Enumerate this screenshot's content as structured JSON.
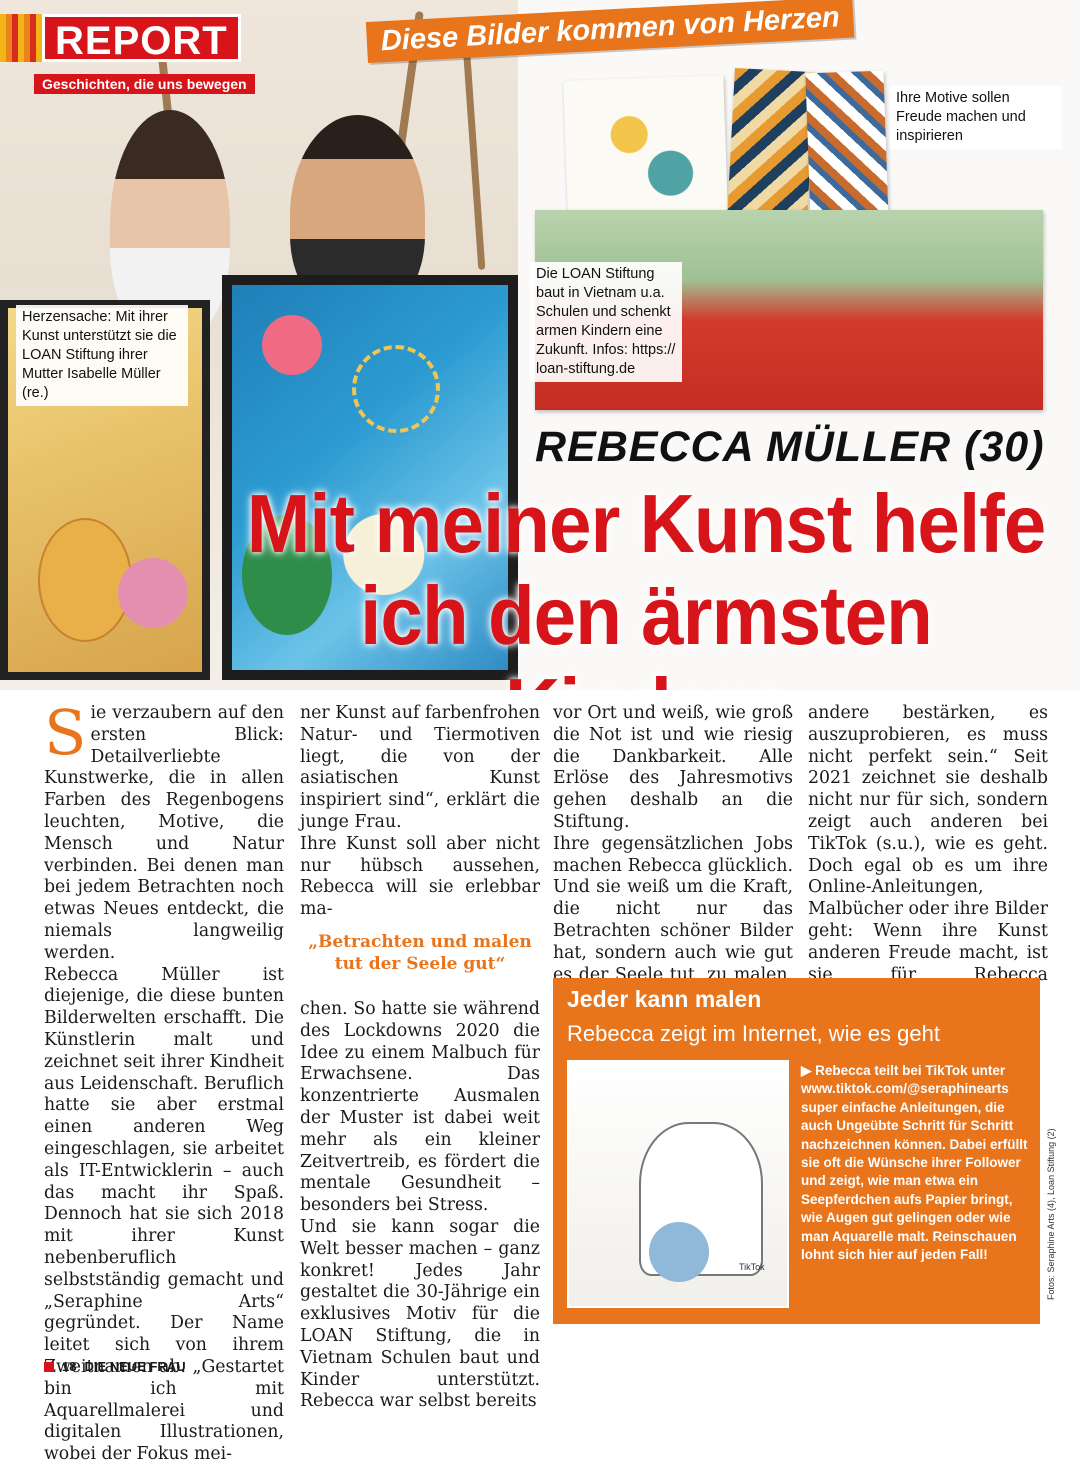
{
  "section": {
    "label": "REPORT",
    "sub": "Geschichten, die uns bewegen"
  },
  "banner": "Diese Bilder kommen von Herzen",
  "captions": {
    "motive": "Ihre Motive sollen Freude machen und inspirieren",
    "loan": "Die LOAN Stiftung baut in Vietnam u.a. Schulen und schenkt armen Kindern eine Zukunft. Infos: https:// loan-stiftung.de",
    "herz": "Herzensache: Mit ihrer Kunst unterstützt sie die LOAN Stiftung ihrer Mutter Isabelle Müller (re.)"
  },
  "kicker": "REBECCA MÜLLER (30)",
  "headline": {
    "line1": "Mit meiner Kunst helfe",
    "line2": "ich den ärmsten Kindern"
  },
  "article": {
    "col1": [
      "ie verzaubern auf den ersten Blick: Detailverliebte Kunstwerke, die in allen Farben des Regenbogens leuchten, Motive, die Mensch und Natur verbinden. Bei denen man bei jedem Betrachten noch etwas Neues entdeckt, die niemals langweilig werden.",
      "Rebecca Müller ist diejenige, die diese bunten Bilderwelten erschafft. Die Künstlerin malt und zeichnet seit ihrer Kindheit aus Leidenschaft. Beruflich hatte sie aber erstmal einen anderen Weg eingeschlagen, sie arbeitet als IT-Entwicklerin – auch das macht ihr Spaß. Dennoch hat sie sich 2018 mit ihrer Kunst nebenberuflich selbstständig gemacht und „Seraphine Arts“ gegründet. Der Name leitet sich von ihrem Zweitnamen ab. „Gestartet bin ich mit Aquarellmalerei und digitalen Illustrationen, wobei der Fokus mei-"
    ],
    "dropcap": "S",
    "col2a": [
      "ner Kunst auf farbenfrohen Natur- und Tiermotiven liegt, die von der asiatischen Kunst inspiriert sind“, erklärt die junge Frau.",
      "Ihre Kunst soll aber nicht nur hübsch aussehen, Rebecca will sie erlebbar ma-"
    ],
    "pullquote": "„Betrachten und malen tut der Seele gut“",
    "col2b": [
      "chen. So hatte sie während des Lockdowns 2020 die Idee zu einem Malbuch für Erwachsene. Das konzentrierte Ausmalen der Muster ist dabei weit mehr als ein kleiner Zeitvertreib, es fördert die mentale Gesundheit – besonders bei Stress.",
      "Und sie kann sogar die Welt besser machen – ganz konkret! Jedes Jahr gestaltet die 30-Jährige ein exklusives Motiv für die LOAN Stiftung, die in Vietnam Schulen baut und Kinder unterstützt. Rebecca war selbst bereits"
    ],
    "col3": [
      "vor Ort und weiß, wie groß die Not ist und wie riesig die Dankbarkeit. Alle Erlöse des Jahresmotivs gehen deshalb an die Stiftung.",
      "Ihre gegensätzlichen Jobs machen Rebecca glücklich. Und sie weiß um die Kraft, die nicht nur das Betrachten schöner Bilder hat, sondern auch wie gut es der Seele tut, zu malen. Sie sagt:„Ich will"
    ],
    "col4": [
      "andere bestärken, es auszuprobieren, es muss nicht perfekt sein.“ Seit 2021 zeichnet sie deshalb nicht nur für sich, sondern zeigt auch anderen bei TikTok (s.u.), wie es geht. Doch egal ob es um ihre Online-Anleitungen, Malbücher oder ihre Bilder geht: Wenn ihre Kunst anderen Freude macht, ist sie für Rebecca erfolgreich."
    ]
  },
  "box": {
    "title": "Jeder kann malen",
    "subtitle": "Rebecca zeigt im Internet, wie es geht",
    "text": "▶ Rebecca teilt bei TikTok unter www.tiktok.com/@seraphinearts super einfache Anleitungen, die auch Ungeübte Schritt für Schritt nachzeichnen können. Dabei erfüllt sie oft die Wünsche ihrer Follower und zeigt, wie man etwa ein Seepferdchen aufs Papier bringt, wie Augen gut gelingen oder wie man Aquarelle malt. Reinschauen lohnt sich hier auf jeden Fall!",
    "tiktok": "TikTok"
  },
  "footer": {
    "page": "18",
    "magazine": "DIE NEUE FRAU"
  },
  "credit": "Fotos: Seraphine Arts (4), Loan Stiftung (2)",
  "colors": {
    "red": "#d7141a",
    "orange": "#e8741c"
  }
}
